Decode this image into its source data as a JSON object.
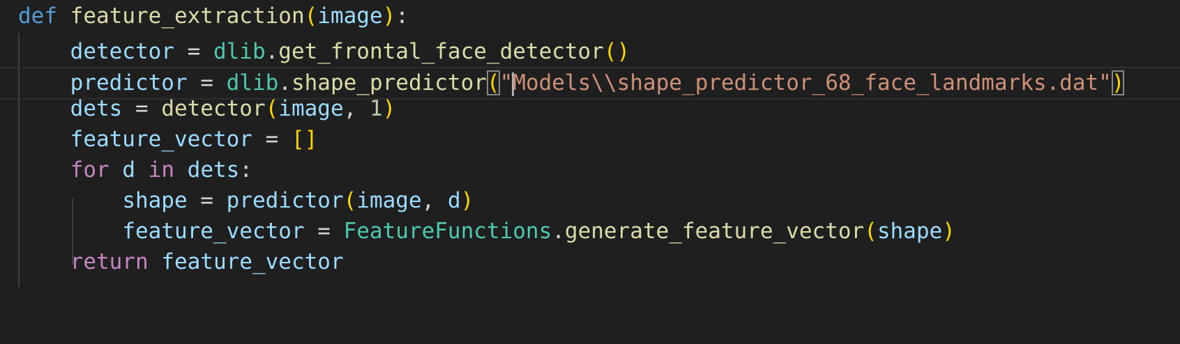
{
  "code": {
    "line1": {
      "kw": "def",
      "fn": "feature_extraction",
      "open": "(",
      "param": "image",
      "close": ")",
      "colon": ":"
    },
    "line2": {
      "var": "detector",
      "eq": " = ",
      "mod": "dlib",
      "dot": ".",
      "fn": "get_frontal_face_detector",
      "parens": "()"
    },
    "line3": {
      "var": "predictor",
      "eq": " = ",
      "mod": "dlib",
      "dot": ".",
      "fn": "shape_predictor",
      "open": "(",
      "quote_open": "\"",
      "str": "Models\\\\shape_predictor_68_face_landmarks.dat\"",
      "close": ")"
    },
    "line4": {
      "var": "dets",
      "eq": " = ",
      "fn": "detector",
      "open": "(",
      "arg1": "image",
      "comma": ", ",
      "num": "1",
      "close": ")"
    },
    "line5": {
      "var": "feature_vector",
      "eq": " = ",
      "brackets": "[]"
    },
    "line6": {
      "kw_for": "for",
      "var_d": "d",
      "kw_in": "in",
      "var_dets": "dets",
      "colon": ":"
    },
    "line7": {
      "var": "shape",
      "eq": " = ",
      "fn": "predictor",
      "open": "(",
      "arg1": "image",
      "comma": ", ",
      "arg2": "d",
      "close": ")"
    },
    "line8": {
      "var": "feature_vector",
      "eq": " = ",
      "mod": "FeatureFunctions",
      "dot": ".",
      "fn": "generate_feature_vector",
      "open": "(",
      "arg": "shape",
      "close": ")"
    },
    "line9": {
      "kw": "return",
      "var": "feature_vector"
    }
  },
  "theme": {
    "background": "#1f1f1f",
    "keyword_def": "#569cd6",
    "keyword_control": "#c586c0",
    "function": "#dcdcaa",
    "variable": "#9cdcfe",
    "module": "#4ec9b0",
    "string": "#ce9178",
    "number": "#b5cea8",
    "bracket_level1": "#ffd700",
    "bracket_level2": "#da70d6"
  }
}
